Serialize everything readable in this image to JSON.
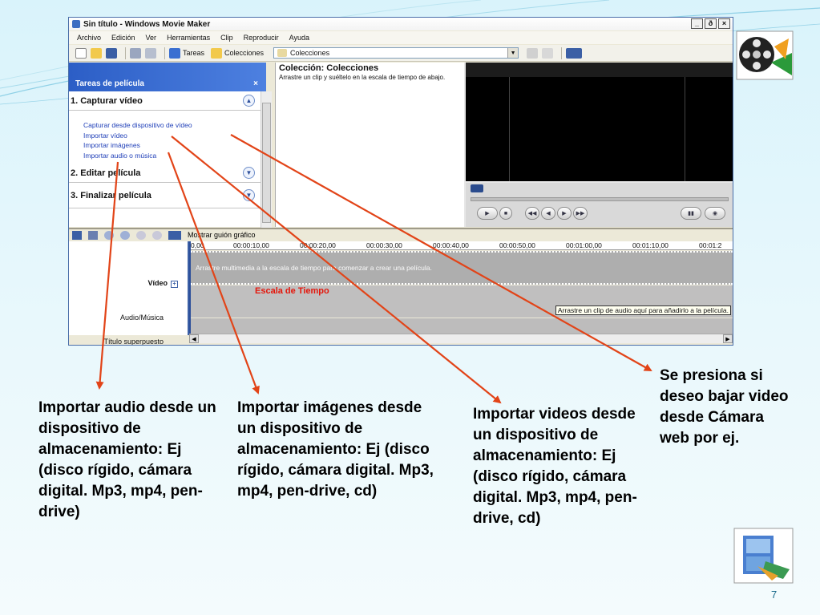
{
  "window": {
    "title": "Sin título - Windows Movie Maker",
    "controls": [
      "_",
      "ð",
      "×"
    ]
  },
  "menu": [
    "Archivo",
    "Edición",
    "Ver",
    "Herramientas",
    "Clip",
    "Reproducir",
    "Ayuda"
  ],
  "toolbar": {
    "tasks_label": "Tareas",
    "collections_label": "Colecciones",
    "collections_combo": "Colecciones"
  },
  "taskpane": {
    "header": "Tareas de película",
    "close": "×",
    "section1": "1. Capturar vídeo",
    "links": [
      "Capturar desde dispositivo de vídeo",
      "Importar vídeo",
      "Importar imágenes",
      "Importar audio o música"
    ],
    "section2": "2. Editar película",
    "section3": "3. Finalizar película"
  },
  "collection": {
    "title": "Colección: Colecciones",
    "hint": "Arrastre un clip y suéltelo en la escala de tiempo de abajo."
  },
  "timeline": {
    "storyboard_label": "Mostrar guión gráfico",
    "ruler": [
      "0,00",
      "00:00:10,00",
      "00:00:20,00",
      "00:00:30,00",
      "00:00:40,00",
      "00:00:50,00",
      "00:01:00,00",
      "00:01:10,00",
      "00:01:2"
    ],
    "track_video": "Vídeo",
    "track_audio": "Audio/Música",
    "track_title": "Título superpuesto",
    "video_hint": "Arrastre multimedia a la escala de tiempo para comenzar a crear una película.",
    "audio_hint": "Arrastre un clip de audio aquí para añadirlo a la película.",
    "scale_label": "Escala de Tiempo"
  },
  "callouts": {
    "audio": "Importar audio desde un dispositivo de almacenamiento: Ej (disco rígido, cámara digital. Mp3, mp4, pen-drive)",
    "images": "Importar imágenes desde un dispositivo de almacenamiento: Ej (disco rígido, cámara digital. Mp3, mp4, pen-drive, cd)",
    "videos": "Importar videos desde un dispositivo de almacenamiento: Ej (disco rígido, cámara digital. Mp3, mp4, pen-drive, cd)",
    "camera": "Se presiona si deseo bajar video desde Cámara web por ej."
  },
  "page_number": "7",
  "colors": {
    "arrow": "#e24418",
    "task_header": "#2c5ec6",
    "link": "#1f3fb8"
  }
}
